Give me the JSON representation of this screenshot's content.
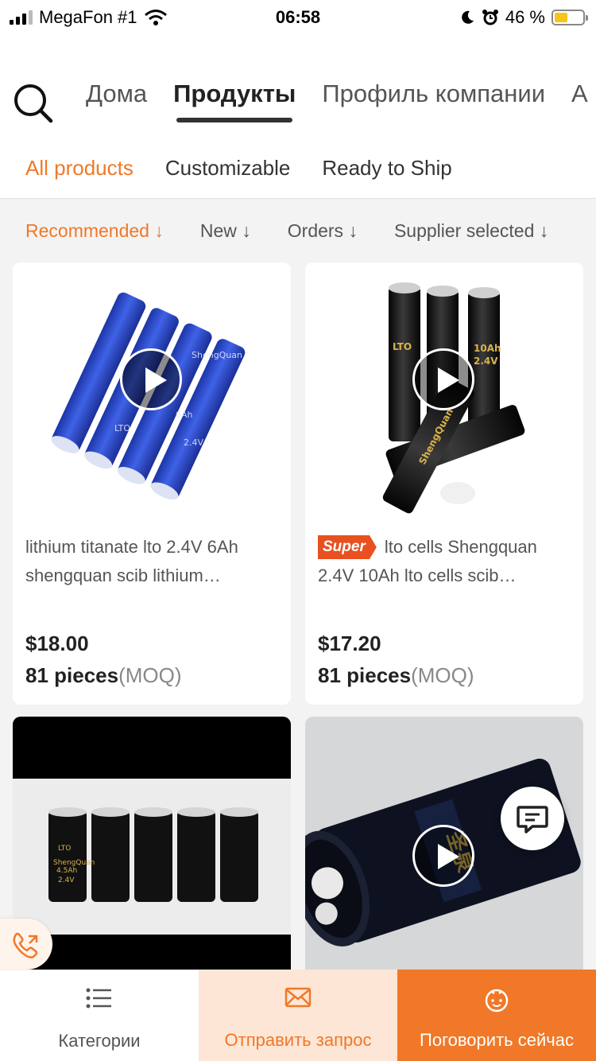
{
  "status_bar": {
    "carrier": "MegaFon #1",
    "time": "06:58",
    "battery_percent": "46 %",
    "battery_level": 0.46
  },
  "nav": {
    "tabs": [
      {
        "label": "Дома"
      },
      {
        "label": "Продукты"
      },
      {
        "label": "Профиль компании"
      },
      {
        "label": "А"
      }
    ],
    "active_tab": "Продукты",
    "subtabs": [
      {
        "label": "All products"
      },
      {
        "label": "Customizable"
      },
      {
        "label": "Ready to Ship"
      }
    ],
    "active_subtab": "All products"
  },
  "sort": {
    "items": [
      {
        "label": "Recommended ↓"
      },
      {
        "label": "New ↓"
      },
      {
        "label": "Orders ↓"
      },
      {
        "label": "Supplier selected ↓"
      }
    ]
  },
  "products": [
    {
      "title": "lithium titanate lto 2.4V 6Ah shengquan scib lithium…",
      "price": "$18.00",
      "moq_qty": "81 pieces",
      "moq_unit": "(MOQ)",
      "has_video": true,
      "battery_color": "#2d49c8",
      "battery_labels": [
        "LTO",
        "6Ah",
        "2.4V",
        "ShengQuan"
      ]
    },
    {
      "badge": "Super",
      "title": "lto cells Shengquan 2.4V 10Ah lto cells scib…",
      "price": "$17.20",
      "moq_qty": "81 pieces",
      "moq_unit": "(MOQ)",
      "has_video": true,
      "battery_color": "#111111",
      "battery_labels": [
        "LTO",
        "10Ah",
        "2.4V",
        "ShengQuan"
      ]
    },
    {
      "has_video": false,
      "battery_color": "#111111",
      "battery_labels": [
        "LTO",
        "4.5Ah",
        "2.4V",
        "ShengQuan"
      ]
    },
    {
      "has_video": true,
      "battery_color": "#151a2a"
    }
  ],
  "bottom_bar": {
    "categories_label": "Категории",
    "inquiry_label": "Отправить запрос",
    "chat_label": "Поговорить сейчас"
  },
  "colors": {
    "accent": "#f07828",
    "badge": "#e8501f"
  },
  "icons": [
    "search-icon",
    "wifi-icon",
    "moon-icon",
    "alarm-icon",
    "battery-icon",
    "play-icon",
    "chat-icon",
    "call-icon",
    "list-icon",
    "mail-icon",
    "smile-icon"
  ]
}
